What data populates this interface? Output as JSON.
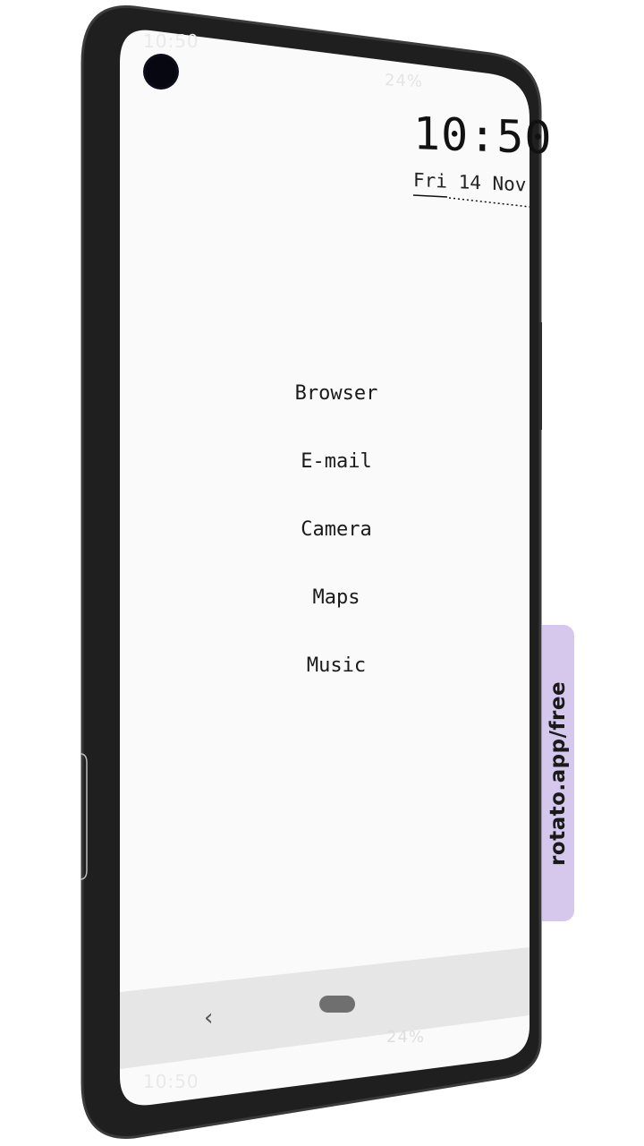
{
  "status_bar": {
    "time": "10:50",
    "battery": "24%"
  },
  "clock": {
    "time": "10:50",
    "date": "Fri 14 Nov"
  },
  "apps": [
    {
      "label": "Browser"
    },
    {
      "label": "E-mail"
    },
    {
      "label": "Camera"
    },
    {
      "label": "Maps"
    },
    {
      "label": "Music"
    }
  ],
  "nav_bar": {
    "back_icon": "chevron-left-icon",
    "back_glyph": "‹",
    "home_icon": "home-pill-icon"
  },
  "watermark": {
    "text": "rotato.app/free"
  },
  "colors": {
    "screen_background": "#fafafa",
    "nav_bar": "#e6e6e6",
    "phone_frame": "#1f1f1f",
    "watermark_tab": "#d6c7ec"
  }
}
